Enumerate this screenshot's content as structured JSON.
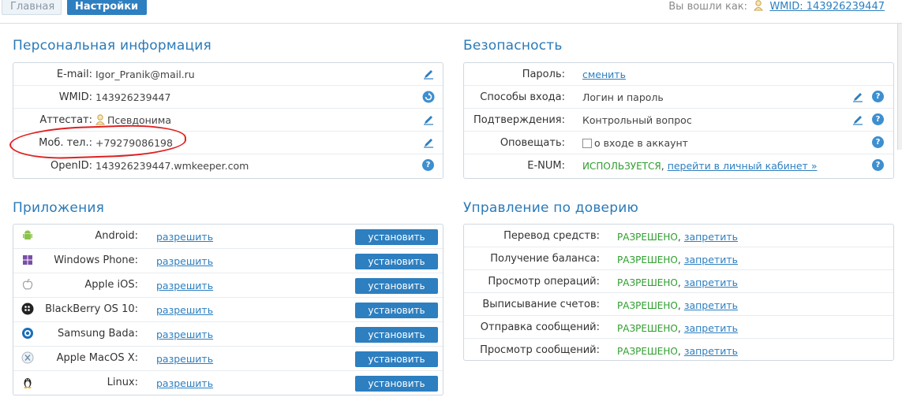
{
  "nav": {
    "home": "Главная",
    "settings": "Настройки"
  },
  "login": {
    "label": "Вы вошли как:",
    "wmid": "WMID: 143926239447"
  },
  "personal": {
    "title": "Персональная информация",
    "rows": [
      {
        "label": "E-mail:",
        "value": "Igor_Pranik@mail.ru",
        "action": "pencil-icon"
      },
      {
        "label": "WMID:",
        "value": "143926239447",
        "action": "refresh-icon"
      },
      {
        "label": "Аттестат:",
        "value": "Псевдонима",
        "action": "pencil-icon"
      },
      {
        "label": "Моб. тел.:",
        "value": "+79279086198",
        "action": "pencil-icon"
      },
      {
        "label": "OpenID:",
        "value": "143926239447.wmkeeper.com",
        "action": "help-icon"
      }
    ]
  },
  "security": {
    "title": "Безопасность",
    "rows": [
      {
        "label": "Пароль:",
        "value": "сменить"
      },
      {
        "label": "Способы входа:",
        "value": "Логин и пароль"
      },
      {
        "label": "Подтверждения:",
        "value": "Контрольный вопрос"
      },
      {
        "label": "Оповещать:",
        "value": "о входе в аккаунт"
      },
      {
        "label": "E-NUM:",
        "status": "ИСПОЛЬЗУЕТСЯ",
        "sep": ",",
        "link": "перейти в личный кабинет »"
      }
    ]
  },
  "apps": {
    "title": "Приложения",
    "allow": "разрешить",
    "install": "установить",
    "rows": [
      {
        "label": "Android:",
        "icon": "android-icon"
      },
      {
        "label": "Windows Phone:",
        "icon": "windows-icon"
      },
      {
        "label": "Apple iOS:",
        "icon": "apple-icon"
      },
      {
        "label": "BlackBerry OS 10:",
        "icon": "blackberry-icon"
      },
      {
        "label": "Samsung Bada:",
        "icon": "bada-icon"
      },
      {
        "label": "Apple MacOS X:",
        "icon": "macos-icon"
      },
      {
        "label": "Linux:",
        "icon": "linux-icon"
      }
    ]
  },
  "trust": {
    "title": "Управление по доверию",
    "status": "РАЗРЕШЕНО",
    "sep": ",",
    "deny": "запретить",
    "rows": [
      {
        "label": "Перевод средств:"
      },
      {
        "label": "Получение баланса:"
      },
      {
        "label": "Просмотр операций:"
      },
      {
        "label": "Выписывание счетов:"
      },
      {
        "label": "Отправка сообщений:"
      },
      {
        "label": "Просмотр сообщений:"
      }
    ]
  },
  "help_glyph": "?",
  "colors": {
    "accent": "#2d7fc0",
    "heading": "#2a7ab8",
    "ok": "#2f9e2f",
    "annotation": "#e02020"
  }
}
